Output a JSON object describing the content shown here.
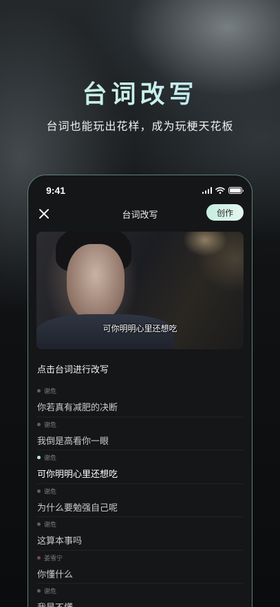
{
  "hero": {
    "title": "台词改写",
    "subtitle": "台词也能玩出花样，成为玩梗天花板"
  },
  "status_bar": {
    "time": "9:41"
  },
  "nav": {
    "title": "台词改写",
    "create_label": "创作"
  },
  "video": {
    "subtitle": "可你明明心里还想吃"
  },
  "hint": "点击台词进行改写",
  "lines": [
    {
      "speaker": "谢危",
      "text": "你若真有减肥的决断",
      "dot_color": "#5e6166"
    },
    {
      "speaker": "谢危",
      "text": "我倒是高看你一眼",
      "dot_color": "#5e6166"
    },
    {
      "speaker": "谢危",
      "text": "可你明明心里还想吃",
      "dot_color": "#bfe9dc"
    },
    {
      "speaker": "谢危",
      "text": "为什么要勉强自己呢",
      "dot_color": "#5e6166"
    },
    {
      "speaker": "谢危",
      "text": "这算本事吗",
      "dot_color": "#5e6166"
    },
    {
      "speaker": "姜雪宁",
      "text": "你懂什么",
      "dot_color": "#6e4c4c"
    },
    {
      "speaker": "谢危",
      "text": "我是不懂",
      "dot_color": "#5e6166"
    }
  ],
  "active_line_index": 2,
  "colors": {
    "accent": "#bfe9dc",
    "background": "#151618"
  }
}
